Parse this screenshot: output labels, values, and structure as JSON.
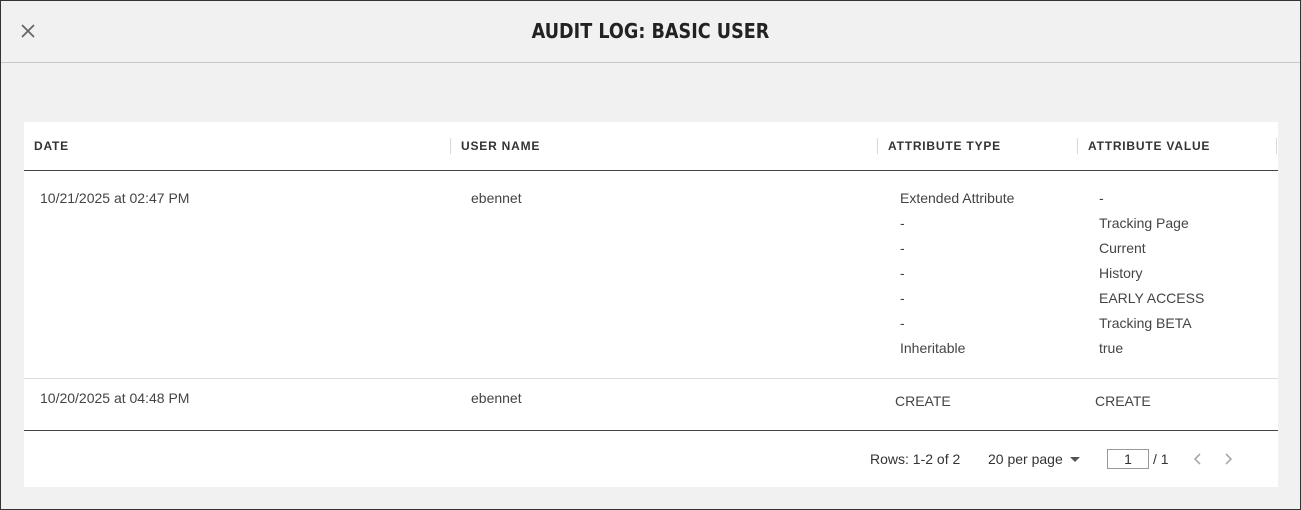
{
  "header": {
    "title": "AUDIT LOG: BASIC USER",
    "close_icon": "close-icon"
  },
  "table": {
    "columns": [
      "DATE",
      "USER NAME",
      "ATTRIBUTE TYPE",
      "ATTRIBUTE VALUE"
    ],
    "rows": [
      {
        "date": "10/21/2025 at 02:47 PM",
        "user_name": "ebennet",
        "attribute_types": [
          "Extended Attribute",
          "-",
          "-",
          "-",
          "-",
          "-",
          "Inheritable"
        ],
        "attribute_values": [
          "-",
          "Tracking Page",
          "Current",
          "History",
          "EARLY ACCESS",
          "Tracking BETA",
          "true"
        ]
      },
      {
        "date": "10/20/2025 at 04:48 PM",
        "user_name": "ebennet",
        "attribute_types": [
          "CREATE"
        ],
        "attribute_values": [
          "CREATE"
        ]
      }
    ]
  },
  "pagination": {
    "rows_info": "Rows: 1-2 of 2",
    "per_page": "20 per page",
    "current_page": "1",
    "total_pages": "/ 1",
    "prev_icon": "chevron-left-icon",
    "next_icon": "chevron-right-icon"
  },
  "colors": {
    "background": "#f1f1f1",
    "card": "#ffffff",
    "text": "#444444"
  }
}
